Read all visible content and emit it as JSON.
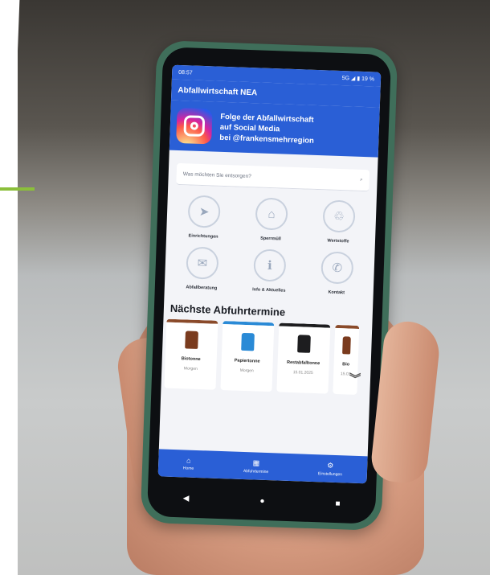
{
  "status_bar": {
    "time": "08:57",
    "indicators": "5G ◢ ▮ 19 %"
  },
  "app_bar": {
    "title": "Abfallwirtschaft NEA"
  },
  "banner": {
    "line1": "Folge der Abfallwirtschaft",
    "line2": "auf Social Media",
    "line3": "bei @frankensmehrregion"
  },
  "search": {
    "placeholder": "Was möchten Sie entsorgen?"
  },
  "tiles": [
    {
      "label": "Einrichtungen",
      "icon": "location-arrow-icon",
      "glyph": "➤"
    },
    {
      "label": "Sperrmüll",
      "icon": "sofa-icon",
      "glyph": "⌂"
    },
    {
      "label": "Wertstoffe",
      "icon": "bin-icon",
      "glyph": "♲"
    },
    {
      "label": "Abfallberatung",
      "icon": "mail-icon",
      "glyph": "✉"
    },
    {
      "label": "Info & Aktuelles",
      "icon": "info-icon",
      "glyph": "ℹ"
    },
    {
      "label": "Kontakt",
      "icon": "phone-icon",
      "glyph": "✆"
    }
  ],
  "section_title": "Nächste Abfuhrtermine",
  "cards": [
    {
      "name": "Biotonne",
      "date": "Morgen",
      "bin_color": "#7a3b1e"
    },
    {
      "name": "Papiertonne",
      "date": "Morgen",
      "bin_color": "#2a8ad6"
    },
    {
      "name": "Restabfalltonne",
      "date": "15.01.2025",
      "bin_color": "#1d1d1f"
    },
    {
      "name": "Bio",
      "date": "15.01",
      "bin_color": "#7a3b1e"
    }
  ],
  "bottom_nav": [
    {
      "label": "Home",
      "glyph": "⌂"
    },
    {
      "label": "Abfuhrtermine",
      "glyph": "▦"
    },
    {
      "label": "Einstellungen",
      "glyph": "⚙"
    }
  ],
  "system_nav": {
    "back": "◀",
    "home": "●",
    "recents": "■"
  },
  "colors": {
    "app_blue": "#2a5fd6",
    "accent_green": "#8bbf3a",
    "phone_case": "#3f6e5a"
  }
}
